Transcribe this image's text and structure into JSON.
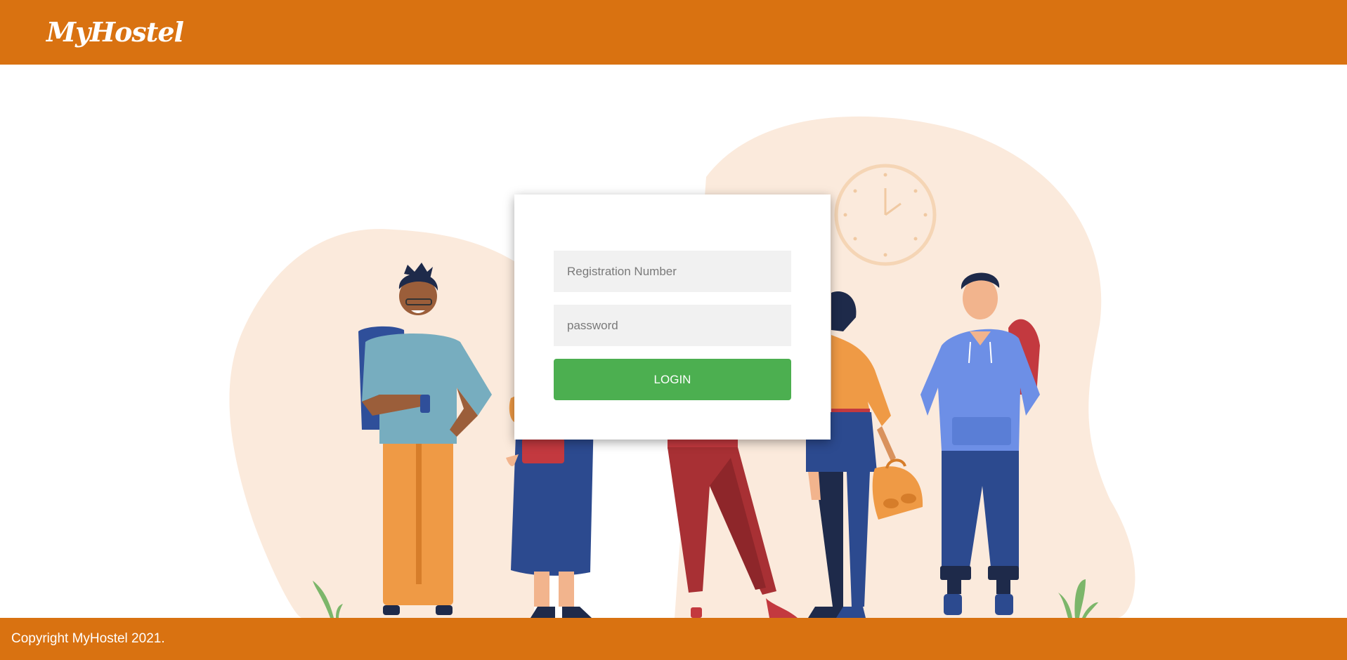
{
  "header": {
    "logo_text": "MyHostel"
  },
  "login_form": {
    "registration_placeholder": "Registration Number",
    "password_placeholder": "password",
    "login_label": "LOGIN"
  },
  "footer": {
    "copyright": "Copyright MyHostel 2021."
  },
  "colors": {
    "brand_orange": "#d97211",
    "login_green": "#4caf50",
    "field_background": "#f1f1f1",
    "backdrop_peach": "#fbeadc"
  },
  "illustration": {
    "icons": [
      "clock-icon",
      "person-illustration",
      "plant-icon",
      "backpack-icon"
    ]
  }
}
